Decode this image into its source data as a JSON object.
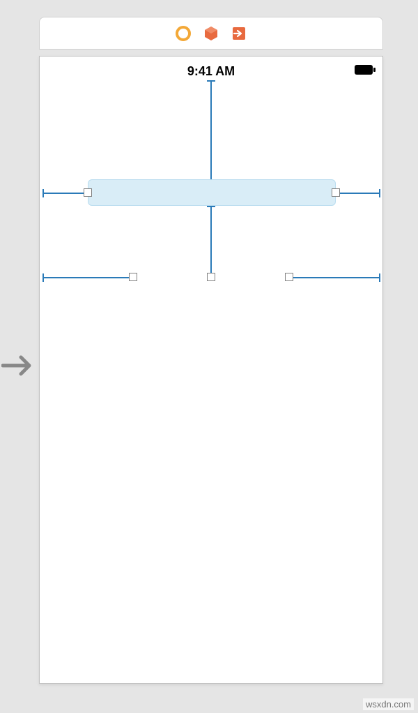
{
  "toolbar": {
    "icons": [
      "identity-inspector-icon",
      "object-library-icon",
      "exit-segue-icon"
    ]
  },
  "status_bar": {
    "time": "9:41 AM"
  },
  "colors": {
    "guide": "#2a7ab8",
    "field_bg": "#d9edf7",
    "toolbar_amber": "#f3a837",
    "toolbar_orange": "#e86a3f"
  },
  "attribution": "wsxdn.com"
}
